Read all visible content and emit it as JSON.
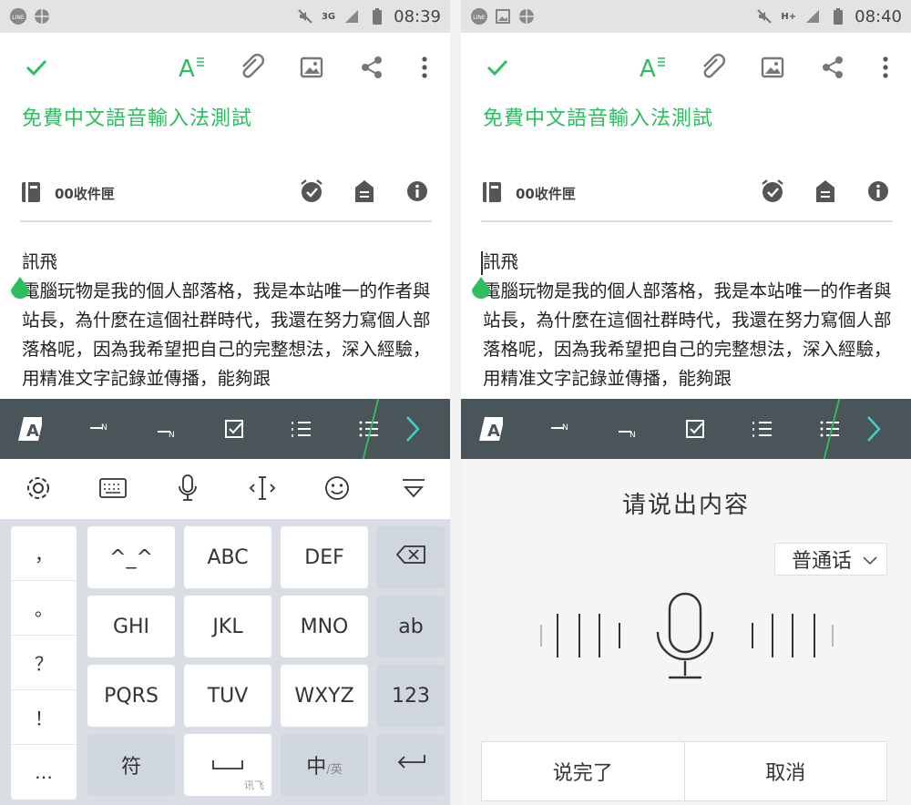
{
  "colors": {
    "accent": "#2dbe60",
    "format_bar": "#4a5559",
    "keyboard_bg": "#d9dee4"
  },
  "left": {
    "status": {
      "time": "08:39",
      "network": "3G"
    },
    "note": {
      "title": "免費中文語音輸入法測試",
      "notebook": "00收件匣",
      "body": "訊飛\n電腦玩物是我的個人部落格，我是本站唯一的作者與站長，為什麼在這個社群時代，我還在努力寫個人部落格呢，因為我希望把自己的完整想法，深入經驗，用精准文字記錄並傳播，能夠跟"
    },
    "keyboard": {
      "punct": [
        "，",
        "。",
        "？",
        "！",
        "…"
      ],
      "rows": [
        [
          "^_^",
          "ABC",
          "DEF"
        ],
        [
          "GHI",
          "JKL",
          "MNO"
        ],
        [
          "PQRS",
          "TUV",
          "WXYZ"
        ]
      ],
      "right_keys": [
        "ab",
        "123"
      ],
      "bottom": {
        "symbol": "符",
        "space_brand": "讯飞",
        "lang_main": "中",
        "lang_sub": "/英"
      }
    }
  },
  "right": {
    "status": {
      "time": "08:40",
      "network": "H+"
    },
    "note": {
      "title": "免費中文語音輸入法測試",
      "notebook": "00收件匣",
      "body": "訊飛\n電腦玩物是我的個人部落格，我是本站唯一的作者與站長，為什麼在這個社群時代，我還在努力寫個人部落格呢，因為我希望把自己的完整想法，深入經驗，用精准文字記錄並傳播，能夠跟"
    },
    "voice": {
      "prompt": "请说出内容",
      "language": "普通话",
      "done": "说完了",
      "cancel": "取消"
    }
  }
}
